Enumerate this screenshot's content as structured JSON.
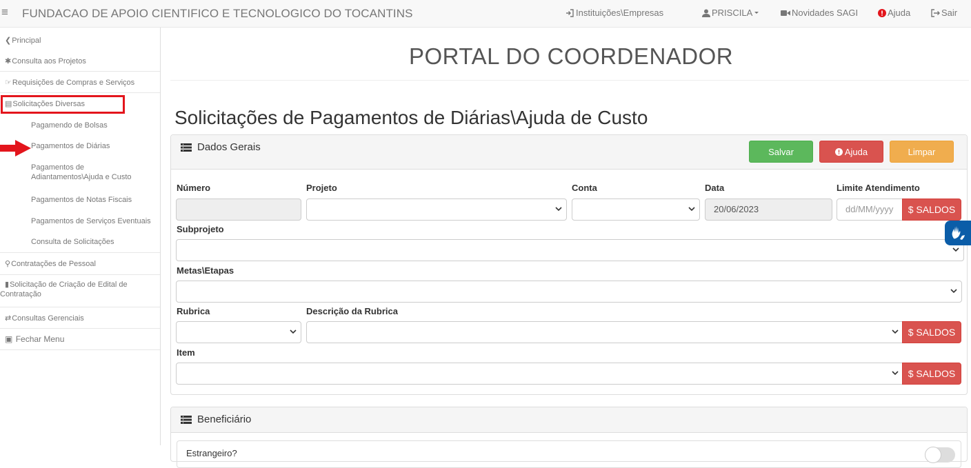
{
  "header": {
    "menu_icon": "hamburger-icon",
    "title": "FUNDACAO DE APOIO CIENTIFICO E TECNOLOGICO DO TOCANTINS",
    "links": {
      "institutions": "Instituições\\Empresas",
      "user": "PRISCILA",
      "news": "Novidades SAGI",
      "help": "Ajuda",
      "logout": "Sair"
    }
  },
  "sidebar": {
    "principal": "Principal",
    "consulta_projetos": "Consulta aos Projetos",
    "requisicoes": "Requisições de Compras e Serviços",
    "solicitacoes": "Solicitações Diversas",
    "sub": {
      "bolsas": "Pagamendo de Bolsas",
      "diarias": "Pagamentos de Diárias",
      "adiantamentos_1": "Pagamentos de",
      "adiantamentos_2": "Adiantamentos\\Ajuda e Custo",
      "notas": "Pagamentos de Notas Fiscais",
      "servicos": "Pagamentos de Serviços Eventuais",
      "consulta": "Consulta de Solicitações"
    },
    "contratacoes": "Contratações de Pessoal",
    "edital_1": "Solicitação de Criação de Edital de",
    "edital_2": "Contratação",
    "gerenciais": "Consultas Gerenciais",
    "fechar": "Fechar Menu"
  },
  "main": {
    "portal_title": "PORTAL DO COORDENADOR",
    "page_title": "Solicitações de Pagamentos de Diárias\\Ajuda de Custo",
    "dados_gerais": {
      "title": "Dados Gerais",
      "buttons": {
        "salvar": "Salvar",
        "ajuda": "Ajuda",
        "limpar": "Limpar"
      },
      "labels": {
        "numero": "Número",
        "projeto": "Projeto",
        "conta": "Conta",
        "data": "Data",
        "limite": "Limite Atendimento",
        "subprojeto": "Subprojeto",
        "metas": "Metas\\Etapas",
        "rubrica": "Rubrica",
        "descricao": "Descrição da Rubrica",
        "item": "Item"
      },
      "values": {
        "numero": "",
        "data": "20/06/2023"
      },
      "placeholders": {
        "limite": "dd/MM/yyyy"
      },
      "saldos_label": "$ SALDOS"
    },
    "beneficiario": {
      "title": "Beneficiário",
      "peek_text": "Estrangeiro?"
    }
  },
  "colors": {
    "success": "#5cb85c",
    "danger": "#d9534f",
    "warning": "#f0ad4e",
    "highlight": "#e3151c",
    "accessibility": "#0b5da8"
  }
}
